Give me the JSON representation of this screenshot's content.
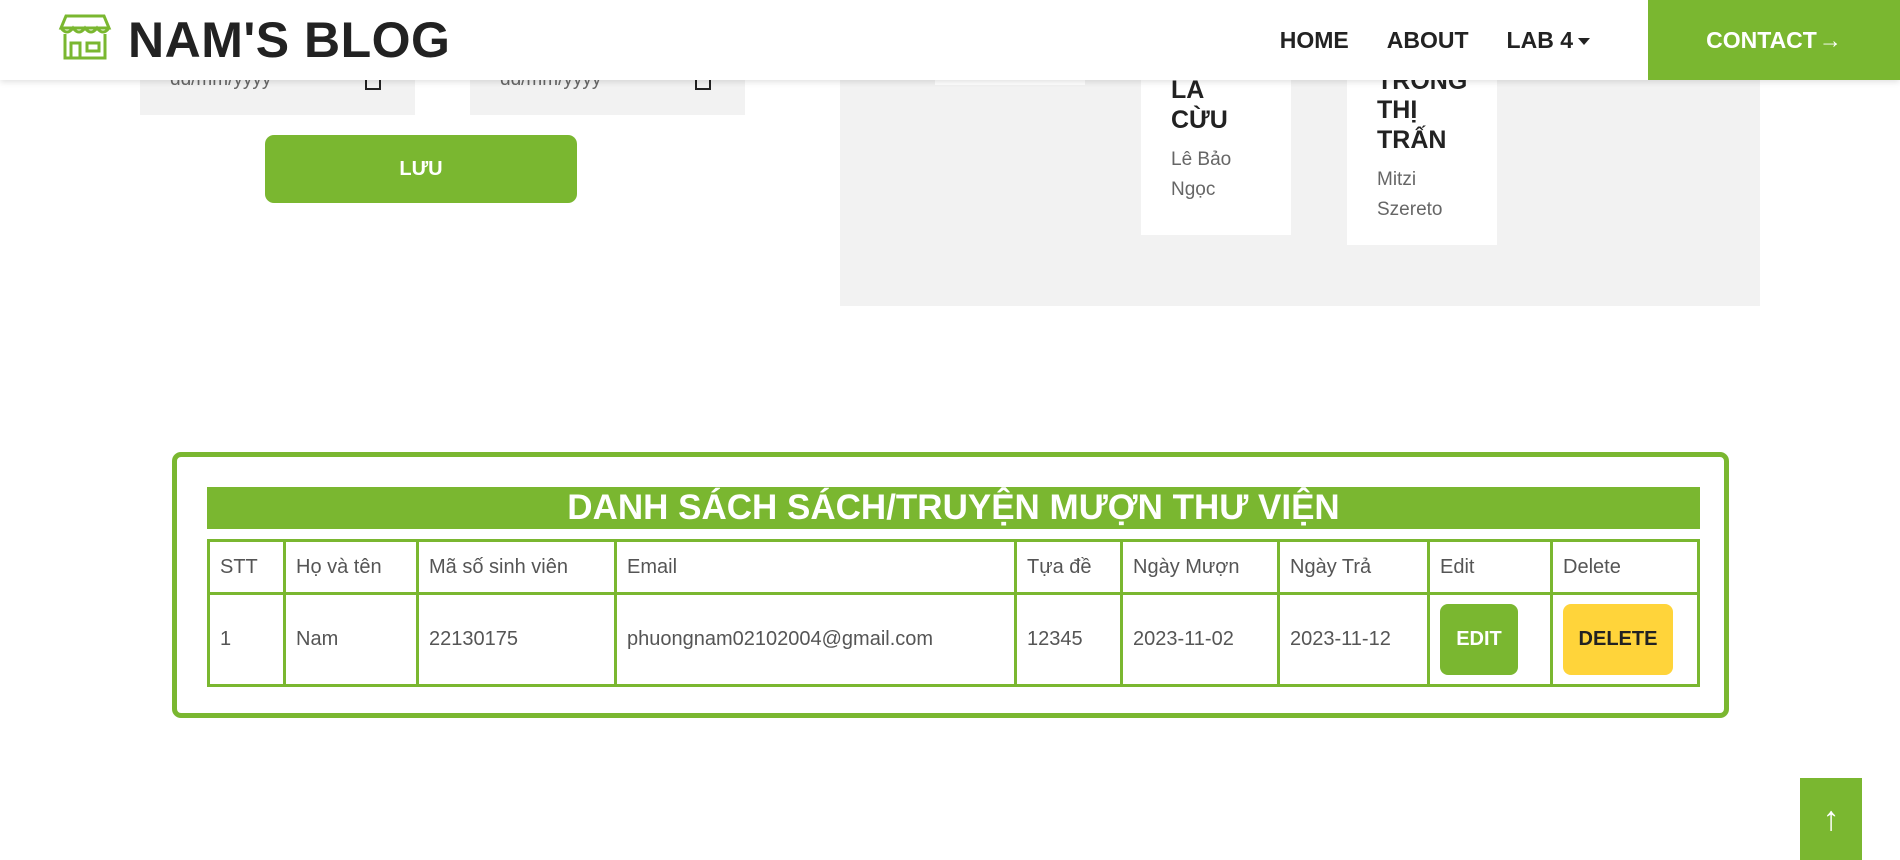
{
  "brand": {
    "name": "NAM'S BLOG",
    "icon": "store-icon"
  },
  "nav": {
    "items": [
      {
        "label": "HOME"
      },
      {
        "label": "ABOUT"
      },
      {
        "label": "LAB 4"
      }
    ],
    "contact_label": "CONTACT",
    "contact_arrow": "→"
  },
  "form": {
    "date_placeholder_1": "dd/mm/yyyy",
    "date_placeholder_2": "dd/mm/yyyy",
    "save_label": "LƯU"
  },
  "books": [
    {
      "title_lines": [
        "LA",
        "CỪU"
      ],
      "author_lines": [
        "Lê Bảo",
        "Ngọc"
      ]
    },
    {
      "title_lines": [
        "TRONG",
        "THỊ",
        "TRẤN"
      ],
      "author_lines": [
        "Mitzi",
        "Szereto"
      ]
    }
  ],
  "borrow_list": {
    "title": "DANH SÁCH SÁCH/TRUYỆN MƯỢN THƯ VIỆN",
    "columns": [
      "STT",
      "Họ và tên",
      "Mã số sinh viên",
      "Email",
      "Tựa đề",
      "Ngày Mượn",
      "Ngày Trả",
      "Edit",
      "Delete"
    ],
    "rows": [
      {
        "stt": "1",
        "name": "Nam",
        "student_id": "22130175",
        "email": "phuongnam02102004@gmail.com",
        "title": "12345",
        "borrow_date": "2023-11-02",
        "return_date": "2023-11-12",
        "edit_label": "EDIT",
        "delete_label": "DELETE"
      }
    ]
  },
  "scroll_top": {
    "icon": "arrow-up-icon",
    "glyph": "↑"
  },
  "colors": {
    "accent": "#7ab730",
    "warning": "#ffd43a",
    "panel": "#f2f2f2",
    "text_dark": "#222222"
  }
}
